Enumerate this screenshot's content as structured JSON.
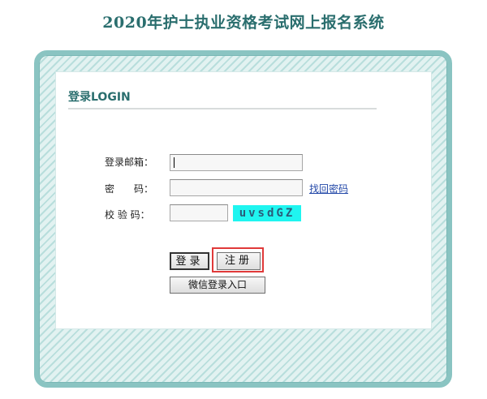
{
  "page": {
    "title": "2020年护士执业资格考试网上报名系统"
  },
  "login": {
    "heading": "登录LOGIN",
    "email_label": "登录邮箱：",
    "email_value": "",
    "password_label": "密　　码：",
    "password_value": "",
    "forgot_link": "找回密码",
    "captcha_label": "校 验 码：",
    "captcha_value": "",
    "captcha_text": "uvsdGZ",
    "login_button": "登录",
    "register_button": "注册",
    "wechat_button": "微信登录入口"
  },
  "colors": {
    "title": "#2a6e6e",
    "frame_border": "#8ac4c2",
    "captcha_bg": "#1ff5f0",
    "highlight": "#e03a3a",
    "link": "#2348a8"
  }
}
